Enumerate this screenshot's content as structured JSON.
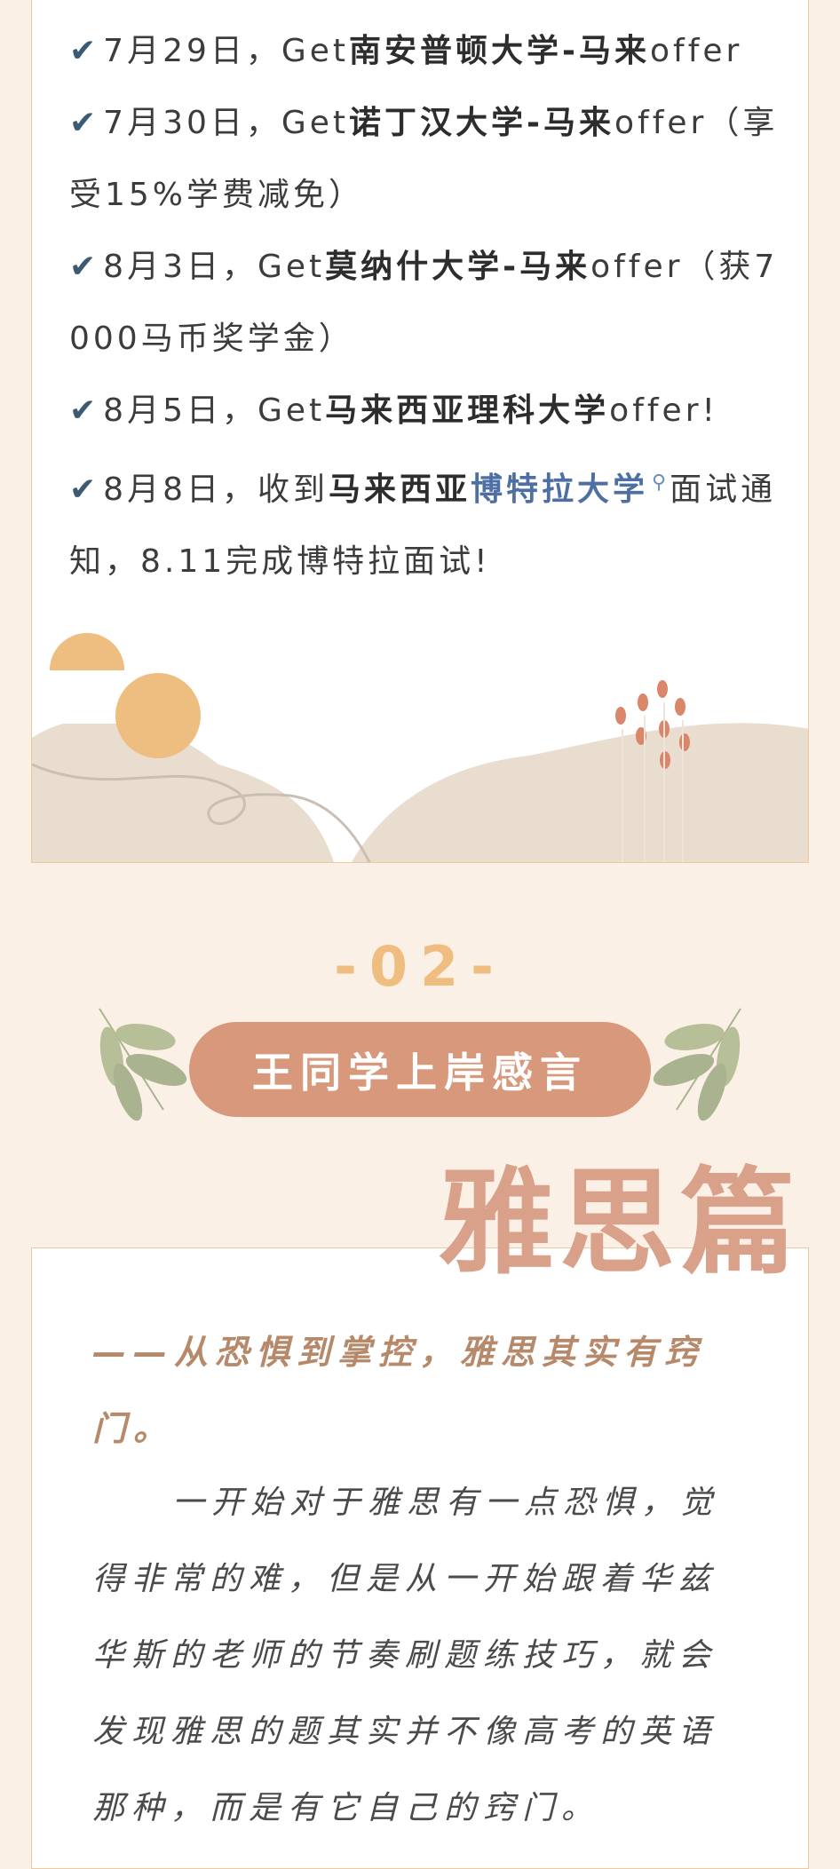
{
  "timeline": {
    "check_icon": "✔",
    "items": [
      {
        "pre": "7月29日，Get",
        "bold": "南安普顿大学-马来",
        "post": "offer"
      },
      {
        "pre": "7月30日，Get",
        "bold": "诺丁汉大学-马来",
        "post": "offer（享受15%学费减免）"
      },
      {
        "pre": "8月3日，Get",
        "bold": "莫纳什大学-马来",
        "post": "offer（获7000马币奖学金）"
      },
      {
        "pre": "8月5日，Get",
        "bold": "马来西亚理科大学",
        "post": "offer!"
      },
      {
        "pre": "8月8日，收到",
        "bold": "马来西亚",
        "link": "博特拉大学",
        "post": "面试通知，8.11完成博特拉面试!"
      }
    ]
  },
  "section": {
    "number": "-02-",
    "title": "王同学上岸感言"
  },
  "story": {
    "category": "雅思篇",
    "subtitle": "——从恐惧到掌控，雅思其实有窍门。",
    "paragraph": "一开始对于雅思有一点恐惧，觉得非常的难，但是从一开始跟着华兹华斯的老师的节奏刷题练技巧，就会发现雅思的题其实并不像高考的英语那种，而是有它自己的窍门。"
  },
  "colors": {
    "accent_orange": "#efbd80",
    "pill": "#d7987b",
    "link_blue": "#4e6fa3",
    "subtitle_brown": "#b5896a"
  }
}
